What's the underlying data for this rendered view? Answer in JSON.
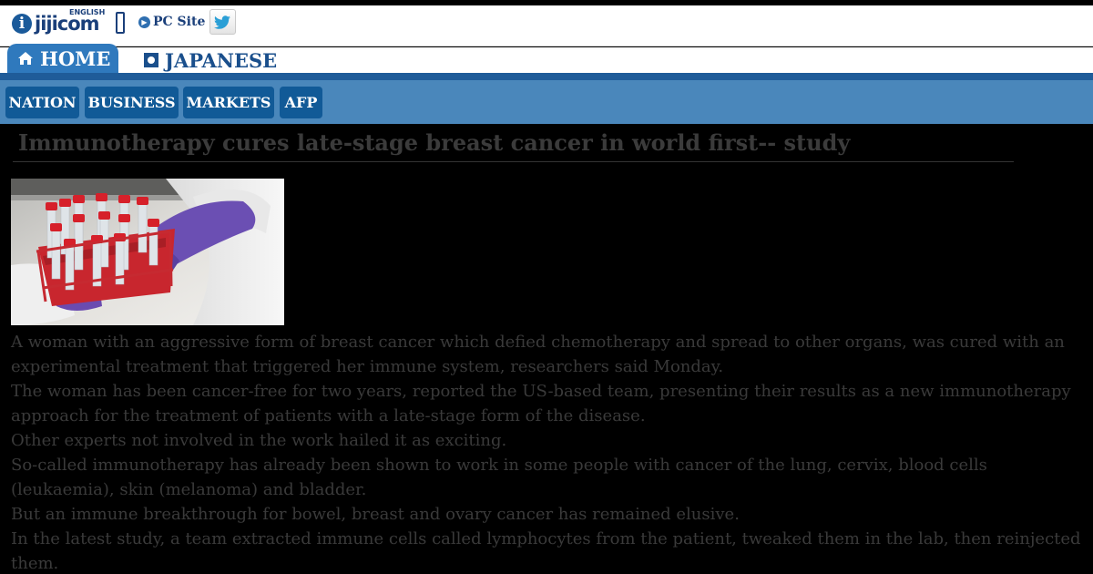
{
  "header": {
    "logo_text": "jijicom",
    "logo_sub": "ENGLISH",
    "logo_letter": "i",
    "pc_site_label": "PC Site",
    "twitter_icon": "twitter-bird-icon"
  },
  "tabs": [
    {
      "label": "HOME",
      "icon": "home-icon",
      "active": true
    },
    {
      "label": "JAPANESE",
      "icon": "square-icon",
      "active": false
    }
  ],
  "nav": [
    {
      "label": "NATION"
    },
    {
      "label": "BUSINESS"
    },
    {
      "label": "MARKETS"
    },
    {
      "label": "AFP"
    }
  ],
  "article": {
    "title": "Immunotherapy cures late-stage breast cancer in world first-- study",
    "paragraphs": [
      "A woman with an aggressive form of breast cancer which defied chemotherapy and spread to other organs, was cured with an experimental treatment that triggered her immune system, researchers said Monday.",
      "The woman has been cancer-free for two years, reported the US-based team, presenting their results as a new immunotherapy approach for the treatment of patients with a late-stage form of the disease.",
      "Other experts not involved in the work hailed it as exciting.",
      "So-called immunotherapy has already been shown to work in some people with cancer of the lung, cervix, blood cells (leukaemia), skin (melanoma) and bladder.",
      "But an immune breakthrough for bowel, breast and ovary cancer has remained elusive.",
      "In the latest study, a team extracted immune cells called lymphocytes from the patient, tweaked them in the lab, then reinjected them."
    ]
  },
  "colors": {
    "brand_blue": "#1a3f7a",
    "tab_blue": "#2f79bd",
    "nav_bar": "#4a87bb",
    "nav_button": "#115a97"
  }
}
